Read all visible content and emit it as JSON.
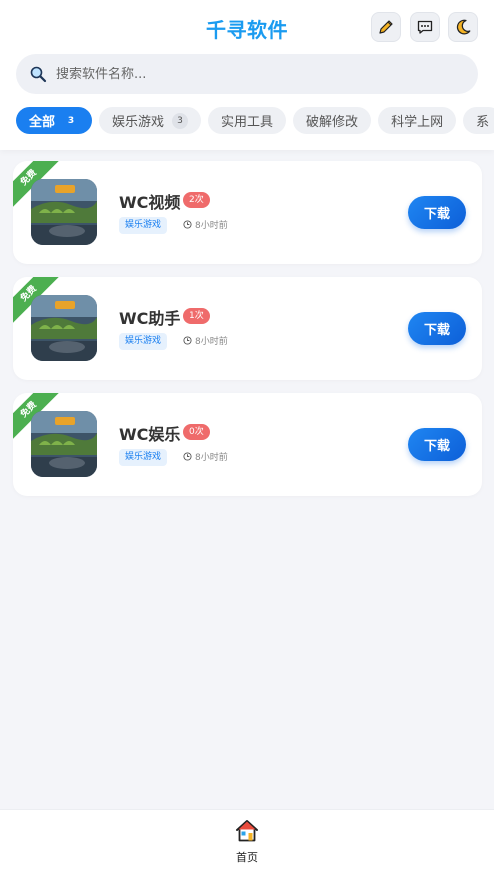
{
  "header": {
    "title": "千寻软件",
    "buttons": [
      "pencil-icon",
      "chat-icon",
      "moon-icon"
    ]
  },
  "search": {
    "placeholder": "搜索软件名称..."
  },
  "tabs": [
    {
      "label": "全部",
      "count": "3",
      "active": true
    },
    {
      "label": "娱乐游戏",
      "count": "3",
      "active": false
    },
    {
      "label": "实用工具"
    },
    {
      "label": "破解修改"
    },
    {
      "label": "科学上网"
    },
    {
      "label": "系"
    }
  ],
  "apps": [
    {
      "ribbon": "免费",
      "name": "WC视频",
      "badge": "2次",
      "category": "娱乐游戏",
      "time": "8小时前",
      "download": "下载"
    },
    {
      "ribbon": "免费",
      "name": "WC助手",
      "badge": "1次",
      "category": "娱乐游戏",
      "time": "8小时前",
      "download": "下载"
    },
    {
      "ribbon": "免费",
      "name": "WC娱乐",
      "badge": "0次",
      "category": "娱乐游戏",
      "time": "8小时前",
      "download": "下载"
    }
  ],
  "bottom_nav": {
    "home_label": "首页"
  },
  "colors": {
    "accent": "#1a7ff0",
    "title": "#1a9bf0",
    "ribbon": "#4caf50",
    "badge": "#ef6b6b"
  }
}
